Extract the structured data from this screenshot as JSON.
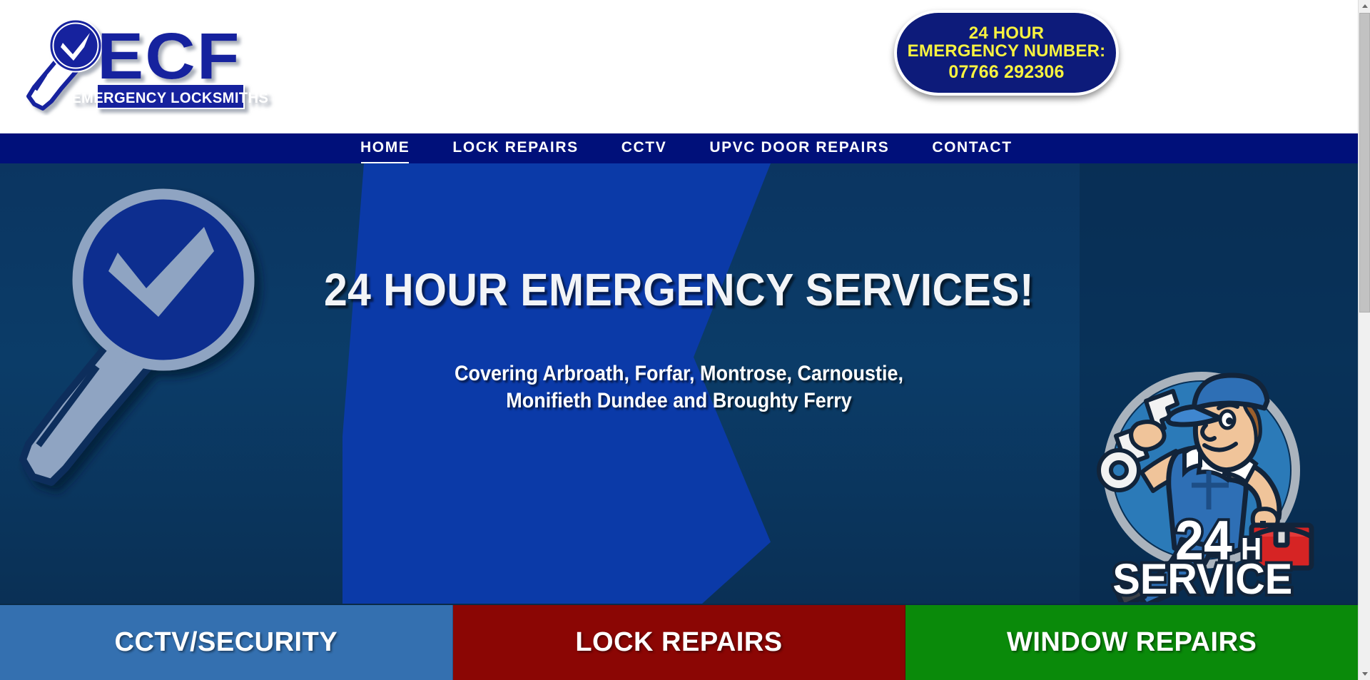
{
  "header": {
    "logo": {
      "name": "ECF Emergency Locksmiths",
      "initials": "ECF",
      "tagline": "EMERGENCY LOCKSMITHS",
      "icon": "key-magnifier-check-icon",
      "color_navy": "#17209e",
      "color_white": "#ffffff"
    },
    "emergency_badge": {
      "line1": "24 HOUR",
      "line2": "EMERGENCY NUMBER:",
      "line3": "07766 292306",
      "text_color": "#f7f240",
      "background_color": "#0d1b7a"
    }
  },
  "nav": {
    "background_color": "#00107a",
    "items": [
      {
        "label": "HOME",
        "active": true
      },
      {
        "label": "LOCK REPAIRS",
        "active": false
      },
      {
        "label": "CCTV",
        "active": false
      },
      {
        "label": "UPVC DOOR REPAIRS",
        "active": false
      },
      {
        "label": "CONTACT",
        "active": false
      }
    ]
  },
  "hero": {
    "background_color": "#0b3a66",
    "accent_color": "#0b3aa8",
    "headline": "24 HOUR EMERGENCY SERVICES!",
    "subline1": "Covering Arbroath, Forfar, Montrose, Carnoustie,",
    "subline2": "Monifieth Dundee and Broughty Ferry",
    "key_graphic": "key-with-checkmark-icon",
    "mascot": {
      "name": "locksmith-mascot-icon",
      "badge_number": "24",
      "badge_unit": "H",
      "badge_word": "SERVICE"
    }
  },
  "services": [
    {
      "label": "CCTV/SECURITY",
      "color": "#3470b0"
    },
    {
      "label": "LOCK REPAIRS",
      "color": "#8b0604"
    },
    {
      "label": "WINDOW REPAIRS",
      "color": "#0a8a0a"
    }
  ],
  "scrollbar": {
    "up_arrow": "scroll-up-icon",
    "down_arrow": "scroll-down-icon"
  }
}
